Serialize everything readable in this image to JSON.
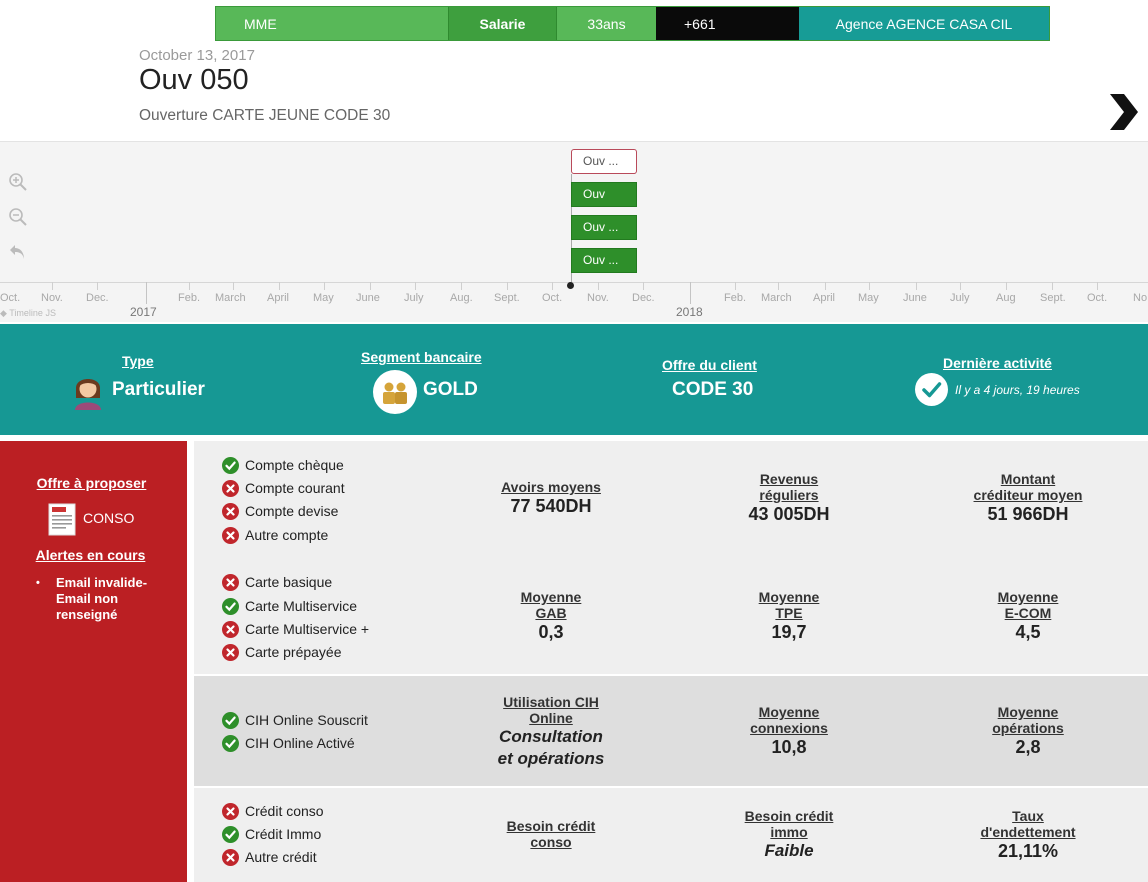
{
  "topbar": {
    "name": "MME",
    "job": "Salarie",
    "age": "33ans",
    "phone": "+661",
    "agency": "Agence AGENCE CASA CIL"
  },
  "header": {
    "date": "October 13, 2017",
    "title": "Ouv 050",
    "subtitle": "Ouverture CARTE JEUNE CODE 30"
  },
  "timeline": {
    "events": [
      "Ouv ...",
      "Ouv",
      "Ouv ...",
      "Ouv ..."
    ],
    "months": [
      "Oct.",
      "Nov.",
      "Dec.",
      "Feb.",
      "March",
      "April",
      "May",
      "June",
      "July",
      "Aug.",
      "Sept.",
      "Oct.",
      "Nov.",
      "Dec.",
      "Feb.",
      "March",
      "April",
      "May",
      "June",
      "July",
      "Aug",
      "Sept.",
      "Oct.",
      "No"
    ],
    "years": [
      "2017",
      "2018"
    ],
    "credit": "Timeline JS"
  },
  "band": {
    "type_label": "Type",
    "type_value": "Particulier",
    "segment_label": "Segment bancaire",
    "segment_value": "GOLD",
    "offer_label": "Offre du client",
    "offer_value": "CODE 30",
    "activity_label": "Dernière activité",
    "activity_value": "Il y a 4 jours, 19 heures"
  },
  "sidebar": {
    "offer_link": "Offre à proposer",
    "offer_value": "CONSO",
    "alerts_link": "Alertes en cours",
    "alerts": [
      "Email invalide-",
      "Email non",
      "renseigné"
    ]
  },
  "accounts": [
    {
      "label": "Compte chèque",
      "status": "ok"
    },
    {
      "label": "Compte courant",
      "status": "no"
    },
    {
      "label": "Compte devise",
      "status": "no"
    },
    {
      "label": "Autre compte",
      "status": "no"
    }
  ],
  "cards": [
    {
      "label": "Carte basique",
      "status": "no"
    },
    {
      "label": "Carte Multiservice",
      "status": "ok"
    },
    {
      "label": "Carte Multiservice +",
      "status": "no"
    },
    {
      "label": "Carte prépayée",
      "status": "no"
    }
  ],
  "online": [
    {
      "label": "CIH Online Souscrit",
      "status": "ok"
    },
    {
      "label": "CIH Online Activé",
      "status": "ok"
    }
  ],
  "credits": [
    {
      "label": "Crédit conso",
      "status": "no"
    },
    {
      "label": "Crédit Immo",
      "status": "ok"
    },
    {
      "label": "Autre crédit",
      "status": "no"
    }
  ],
  "metrics": {
    "avoirs": {
      "l1": "Avoirs moyens",
      "value": "77 540DH"
    },
    "revenus": {
      "l1": "Revenus",
      "l2": "réguliers",
      "value": "43 005DH"
    },
    "montant": {
      "l1": "Montant",
      "l2": "créditeur moyen",
      "value": "51 966DH"
    },
    "gab": {
      "l1": "Moyenne",
      "l2": "GAB",
      "value": "0,3"
    },
    "tpe": {
      "l1": "Moyenne",
      "l2": "TPE",
      "value": "19,7"
    },
    "ecom": {
      "l1": "Moyenne",
      "l2": "E-COM",
      "value": "4,5"
    },
    "utilisation": {
      "l1": "Utilisation CIH",
      "l2": "Online",
      "v1": "Consultation",
      "v2": "et opérations"
    },
    "connexions": {
      "l1": "Moyenne",
      "l2": "connexions",
      "value": "10,8"
    },
    "operations": {
      "l1": "Moyenne",
      "l2": "opérations",
      "value": "2,8"
    },
    "besoin_conso": {
      "l1": "Besoin crédit",
      "l2": "conso"
    },
    "besoin_immo": {
      "l1": "Besoin crédit",
      "l2": "immo",
      "value": "Faible"
    },
    "taux": {
      "l1": "Taux",
      "l2": "d'endettement",
      "value": "21,11%"
    }
  },
  "colors": {
    "ok": "#2e8f2a",
    "no": "#c0262c",
    "teal": "#169894",
    "red": "#bb1f23"
  },
  "icons": {
    "ok": "check-circle-icon",
    "no": "cross-circle-icon"
  }
}
